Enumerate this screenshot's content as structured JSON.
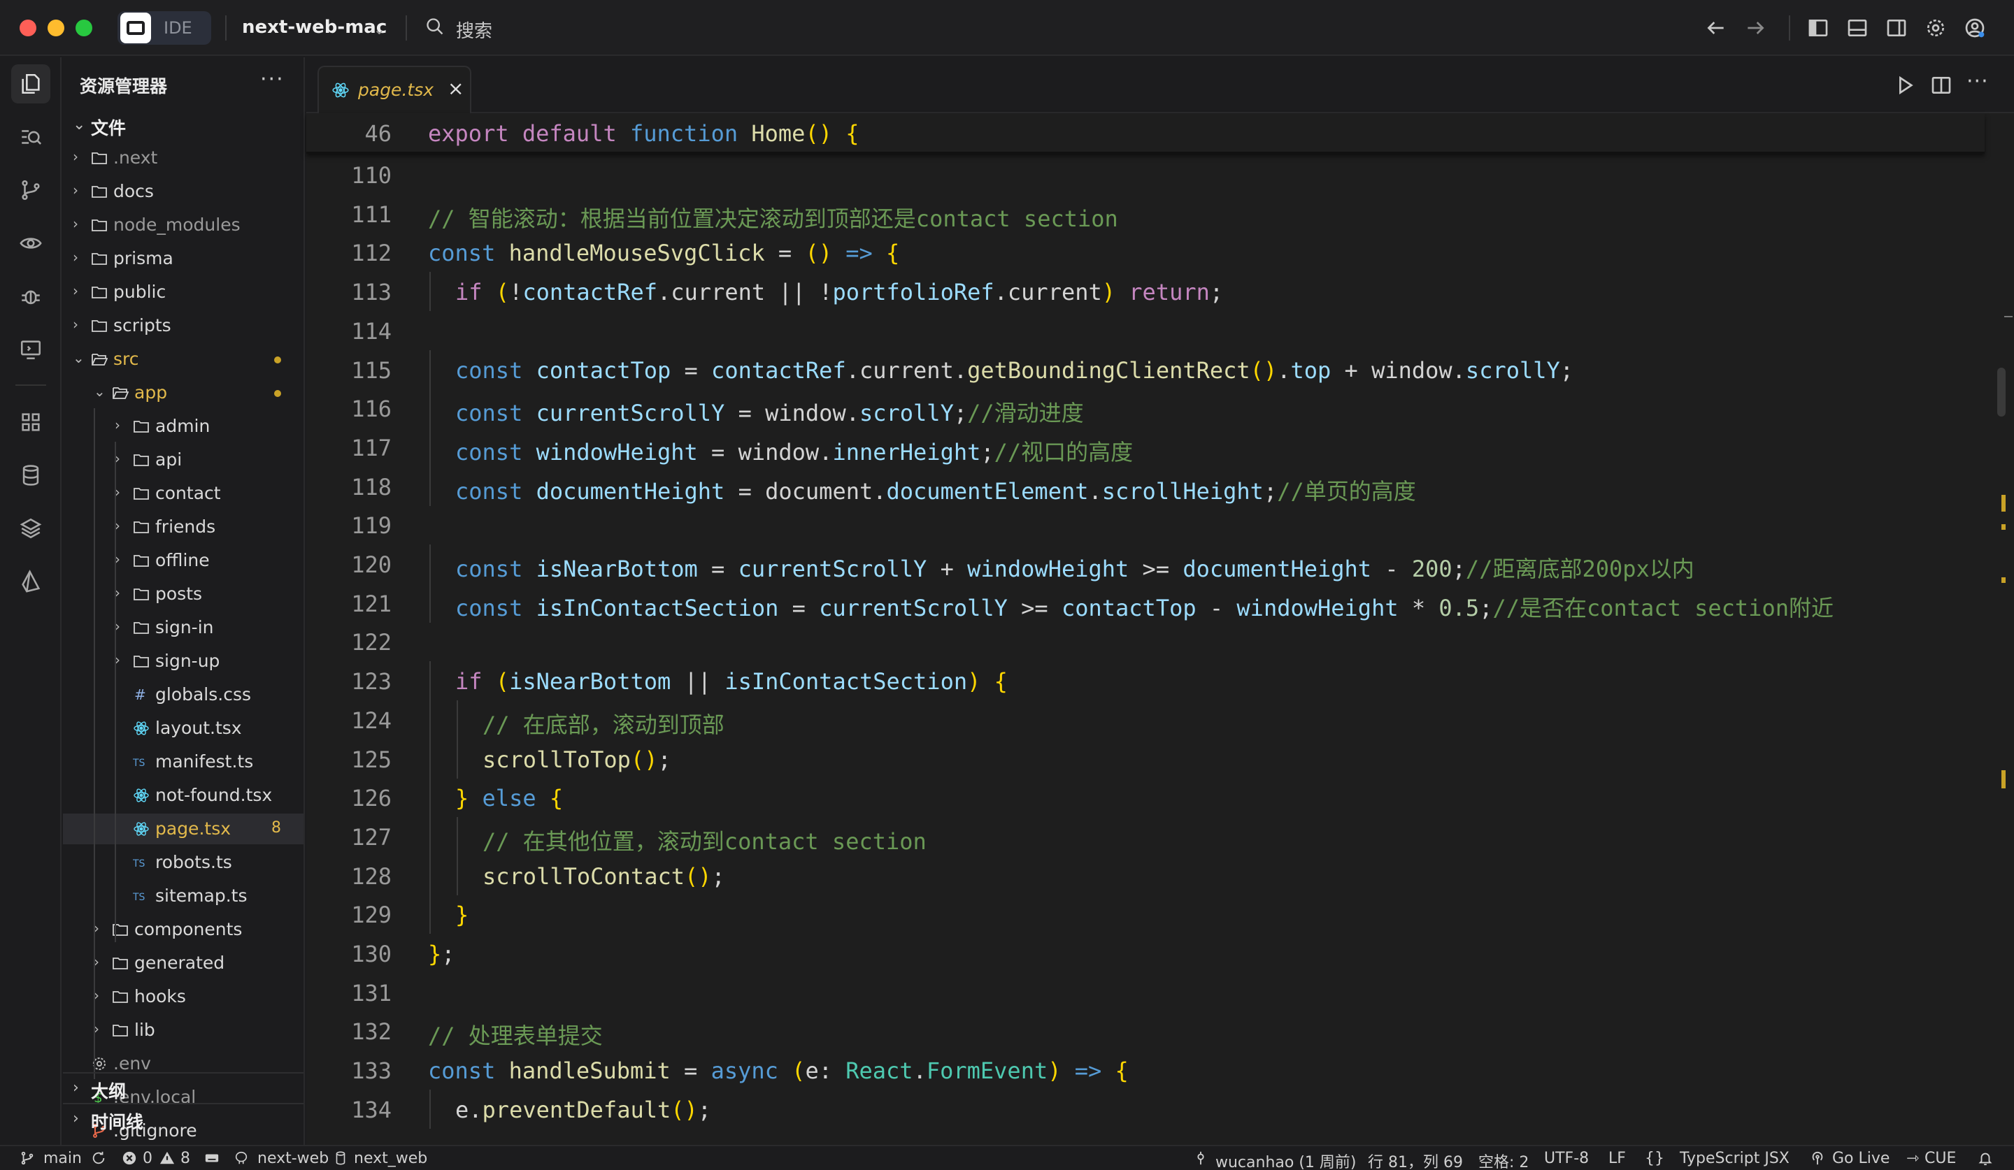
{
  "titlebar": {
    "ide_label": "IDE",
    "project": "next-web-mac",
    "search_label": "搜索"
  },
  "sidebar": {
    "title": "资源管理器",
    "more": "···",
    "files_header": "文件",
    "tree": [
      {
        "label": ".next",
        "kind": "folder",
        "depth": 0,
        "muted": true
      },
      {
        "label": "docs",
        "kind": "folder",
        "depth": 0
      },
      {
        "label": "node_modules",
        "kind": "folder",
        "depth": 0,
        "muted": true
      },
      {
        "label": "prisma",
        "kind": "folder",
        "depth": 0
      },
      {
        "label": "public",
        "kind": "folder",
        "depth": 0
      },
      {
        "label": "scripts",
        "kind": "folder",
        "depth": 0
      },
      {
        "label": "src",
        "kind": "folder-open",
        "depth": 0,
        "modified": true
      },
      {
        "label": "app",
        "kind": "folder-open",
        "depth": 1,
        "modified": true
      },
      {
        "label": "admin",
        "kind": "folder",
        "depth": 2
      },
      {
        "label": "api",
        "kind": "folder",
        "depth": 2
      },
      {
        "label": "contact",
        "kind": "folder",
        "depth": 2
      },
      {
        "label": "friends",
        "kind": "folder",
        "depth": 2
      },
      {
        "label": "offline",
        "kind": "folder",
        "depth": 2
      },
      {
        "label": "posts",
        "kind": "folder",
        "depth": 2
      },
      {
        "label": "sign-in",
        "kind": "folder",
        "depth": 2
      },
      {
        "label": "sign-up",
        "kind": "folder",
        "depth": 2
      },
      {
        "label": "globals.css",
        "kind": "css",
        "depth": 2
      },
      {
        "label": "layout.tsx",
        "kind": "react",
        "depth": 2
      },
      {
        "label": "manifest.ts",
        "kind": "ts",
        "depth": 2
      },
      {
        "label": "not-found.tsx",
        "kind": "react",
        "depth": 2
      },
      {
        "label": "page.tsx",
        "kind": "react",
        "depth": 2,
        "selected": true,
        "badge": "8"
      },
      {
        "label": "robots.ts",
        "kind": "ts",
        "depth": 2
      },
      {
        "label": "sitemap.ts",
        "kind": "ts",
        "depth": 2
      },
      {
        "label": "components",
        "kind": "folder",
        "depth": 1
      },
      {
        "label": "generated",
        "kind": "folder",
        "depth": 1
      },
      {
        "label": "hooks",
        "kind": "folder",
        "depth": 1
      },
      {
        "label": "lib",
        "kind": "folder",
        "depth": 1
      },
      {
        "label": ".env",
        "kind": "gear",
        "depth": 0,
        "muted": true
      },
      {
        "label": ".env.local",
        "kind": "dollar",
        "depth": 0,
        "muted": true
      },
      {
        "label": ".gitignore",
        "kind": "git",
        "depth": 0
      }
    ],
    "outline_header": "大纲",
    "timeline_header": "时间线"
  },
  "editor": {
    "tab_label": "page.tsx",
    "tab_close": "×",
    "sticky": {
      "num": "46",
      "code": "export default function Home() {"
    },
    "lines": [
      {
        "num": "110",
        "indent": 0,
        "code": ""
      },
      {
        "num": "111",
        "indent": 1,
        "code": "// 智能滚动：根据当前位置决定滚动到顶部还是contact section"
      },
      {
        "num": "112",
        "indent": 1,
        "code": "const handleMouseSvgClick = () => {"
      },
      {
        "num": "113",
        "indent": 2,
        "code": "if (!contactRef.current || !portfolioRef.current) return;"
      },
      {
        "num": "114",
        "indent": 0,
        "code": ""
      },
      {
        "num": "115",
        "indent": 2,
        "code": "const contactTop = contactRef.current.getBoundingClientRect().top + window.scrollY;"
      },
      {
        "num": "116",
        "indent": 2,
        "code": "const currentScrollY = window.scrollY;//滑动进度"
      },
      {
        "num": "117",
        "indent": 2,
        "code": "const windowHeight = window.innerHeight;//视口的高度"
      },
      {
        "num": "118",
        "indent": 2,
        "code": "const documentHeight = document.documentElement.scrollHeight;//单页的高度"
      },
      {
        "num": "119",
        "indent": 0,
        "code": ""
      },
      {
        "num": "120",
        "indent": 2,
        "code": "const isNearBottom = currentScrollY + windowHeight >= documentHeight - 200;//距离底部200px以内"
      },
      {
        "num": "121",
        "indent": 2,
        "code": "const isInContactSection = currentScrollY >= contactTop - windowHeight * 0.5;//是否在contact section附近"
      },
      {
        "num": "122",
        "indent": 0,
        "code": ""
      },
      {
        "num": "123",
        "indent": 2,
        "code": "if (isNearBottom || isInContactSection) {"
      },
      {
        "num": "124",
        "indent": 3,
        "code": "// 在底部，滚动到顶部"
      },
      {
        "num": "125",
        "indent": 3,
        "code": "scrollToTop();"
      },
      {
        "num": "126",
        "indent": 2,
        "code": "} else {"
      },
      {
        "num": "127",
        "indent": 3,
        "code": "// 在其他位置，滚动到contact section"
      },
      {
        "num": "128",
        "indent": 3,
        "code": "scrollToContact();"
      },
      {
        "num": "129",
        "indent": 2,
        "code": "}"
      },
      {
        "num": "130",
        "indent": 1,
        "code": "};"
      },
      {
        "num": "131",
        "indent": 0,
        "code": ""
      },
      {
        "num": "132",
        "indent": 1,
        "code": "// 处理表单提交"
      },
      {
        "num": "133",
        "indent": 1,
        "code": "const handleSubmit = async (e: React.FormEvent) => {"
      },
      {
        "num": "134",
        "indent": 2,
        "code": "e.preventDefault();"
      }
    ]
  },
  "statusbar": {
    "branch": "main",
    "errors": "0",
    "warnings": "8",
    "remote": "next-web",
    "db": "next_web",
    "blame": "wucanhao (1 周前)",
    "position": "行 81，列 69",
    "spaces": "空格: 2",
    "encoding": "UTF-8",
    "eol": "LF",
    "braces": "{}",
    "language": "TypeScript JSX",
    "golive": "Go Live",
    "cue": "CUE"
  },
  "colors": {
    "modified": "#c9a227",
    "warning_badge": "#e2b94b",
    "comment": "#6a9955",
    "keyword": "#569cd6"
  }
}
